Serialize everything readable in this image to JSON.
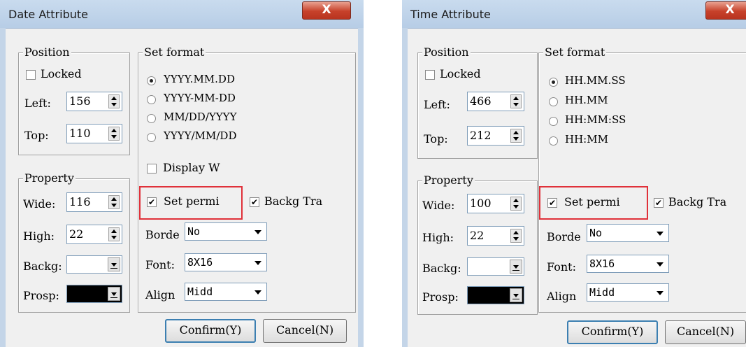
{
  "date_dialog": {
    "title": "Date Attribute",
    "close": "X",
    "position": {
      "label": "Position",
      "locked_label": "Locked",
      "left_label": "Left:",
      "left_value": "156",
      "top_label": "Top:",
      "top_value": "110"
    },
    "format": {
      "label": "Set format",
      "options": [
        "YYYY.MM.DD",
        "YYYY-MM-DD",
        "MM/DD/YYYY",
        "YYYY/MM/DD"
      ],
      "selected_index": 0,
      "display_week_label": "Display W"
    },
    "property": {
      "label": "Property",
      "wide_label": "Wide:",
      "wide_value": "116",
      "high_label": "High:",
      "high_value": "22",
      "backg_label": "Backg:",
      "prosp_label": "Prosp:"
    },
    "set_permi_label": "Set permi",
    "backg_tra_label": "Backg Tra",
    "border": {
      "label": "Borde",
      "value": "No"
    },
    "font": {
      "label": "Font:",
      "value": "8X16"
    },
    "align": {
      "label": "Align",
      "value": "Midd"
    },
    "confirm_label": "Confirm(Y)",
    "cancel_label": "Cancel(N)"
  },
  "time_dialog": {
    "title": "Time Attribute",
    "close": "X",
    "position": {
      "label": "Position",
      "locked_label": "Locked",
      "left_label": "Left:",
      "left_value": "466",
      "top_label": "Top:",
      "top_value": "212"
    },
    "format": {
      "label": "Set format",
      "options": [
        "HH.MM.SS",
        "HH.MM",
        "HH:MM:SS",
        "HH:MM"
      ],
      "selected_index": 0
    },
    "property": {
      "label": "Property",
      "wide_label": "Wide:",
      "wide_value": "100",
      "high_label": "High:",
      "high_value": "22",
      "backg_label": "Backg:",
      "prosp_label": "Prosp:"
    },
    "set_permi_label": "Set permi",
    "backg_tra_label": "Backg Tra",
    "border": {
      "label": "Borde",
      "value": "No"
    },
    "font": {
      "label": "Font:",
      "value": "8X16"
    },
    "align": {
      "label": "Align",
      "value": "Midd"
    },
    "confirm_label": "Confirm(Y)",
    "cancel_label": "Cancel(N)"
  },
  "colors": {
    "highlight": "#e0313a",
    "titlebar": "#c9dbee",
    "dialog_bg": "#f0f0f0",
    "close_button": "#c7412a"
  }
}
